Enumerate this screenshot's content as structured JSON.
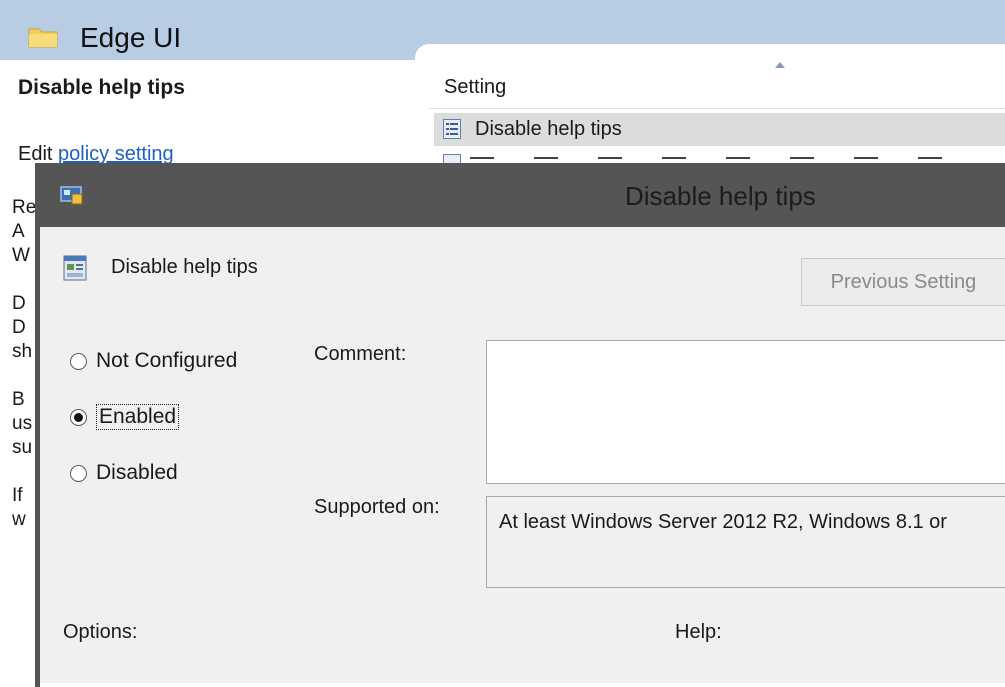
{
  "background_window": {
    "folder_title": "Edge UI",
    "left_pane": {
      "heading": "Disable help tips",
      "edit_prefix": "Edit",
      "edit_link": "policy setting",
      "clipped_chars": [
        "Re",
        "A",
        "W",
        "",
        "D",
        "D",
        "sh",
        "",
        "B",
        "us",
        "su",
        "",
        "If",
        "w"
      ]
    },
    "list": {
      "column_header": "Setting",
      "selected_row": "Disable help tips"
    }
  },
  "dialog": {
    "title": "Disable help tips",
    "policy_name": "Disable help tips",
    "previous_button": "Previous Setting",
    "radios": [
      {
        "label": "Not Configured",
        "checked": false
      },
      {
        "label": "Enabled",
        "checked": true
      },
      {
        "label": "Disabled",
        "checked": false
      }
    ],
    "comment_label": "Comment:",
    "comment_value": "",
    "supported_label": "Supported on:",
    "supported_value": "At least Windows Server 2012 R2, Windows 8.1 or",
    "options_label": "Options:",
    "help_label": "Help:"
  },
  "colors": {
    "titlebar": "#555555",
    "dialog_bg": "#f0f0f0",
    "header_blue": "#b8cde4",
    "link": "#1f5fbf"
  },
  "icons": [
    "folder-icon",
    "policy-list-icon",
    "app-window-icon",
    "policy-setting-icon"
  ]
}
